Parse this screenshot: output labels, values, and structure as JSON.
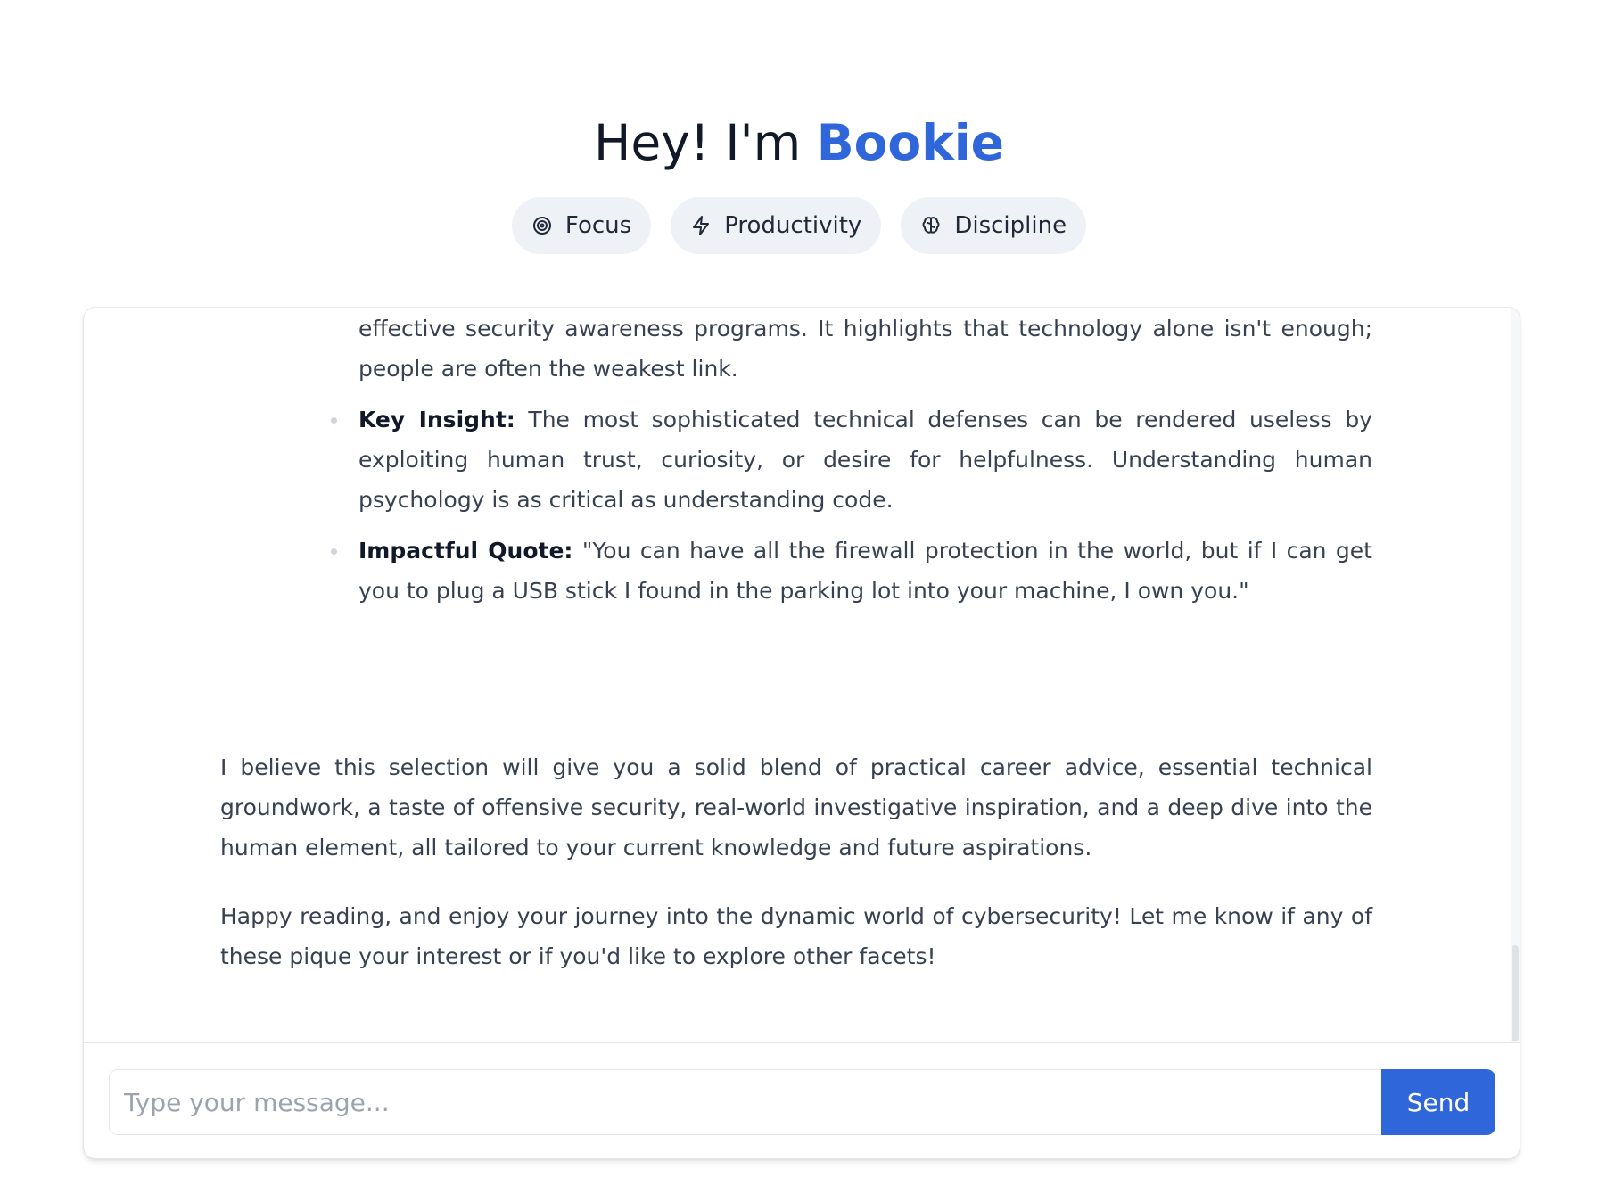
{
  "header": {
    "greeting": "Hey! I'm ",
    "brand": "Bookie"
  },
  "chips": [
    {
      "label": "Focus",
      "icon": "target-icon"
    },
    {
      "label": "Productivity",
      "icon": "lightning-icon"
    },
    {
      "label": "Discipline",
      "icon": "brain-icon"
    }
  ],
  "chat": {
    "partial_item": {
      "text": "incredibly insightful not only for defending against these attacks but also for building effective security awareness programs. It highlights that technology alone isn't enough; people are often the weakest link."
    },
    "bullets": [
      {
        "label": "Key Insight:",
        "text": " The most sophisticated technical defenses can be rendered useless by exploiting human trust, curiosity, or desire for helpfulness. Understanding human psychology is as critical as understanding code."
      },
      {
        "label": "Impactful Quote:",
        "text": " \"You can have all the firewall protection in the world, but if I can get you to plug a USB stick I found in the parking lot into your machine, I own you.\""
      }
    ],
    "paragraphs": [
      "I believe this selection will give you a solid blend of practical career advice, essential technical groundwork, a taste of offensive security, real-world investigative inspiration, and a deep dive into the human element, all tailored to your current knowledge and future aspirations.",
      "Happy reading, and enjoy your journey into the dynamic world of cybersecurity! Let me know if any of these pique your interest or if you'd like to explore other facets!"
    ]
  },
  "composer": {
    "placeholder": "Type your message...",
    "send_label": "Send"
  },
  "colors": {
    "brand": "#2f66d9",
    "chip_bg": "#eef2f7",
    "text": "#374151"
  }
}
